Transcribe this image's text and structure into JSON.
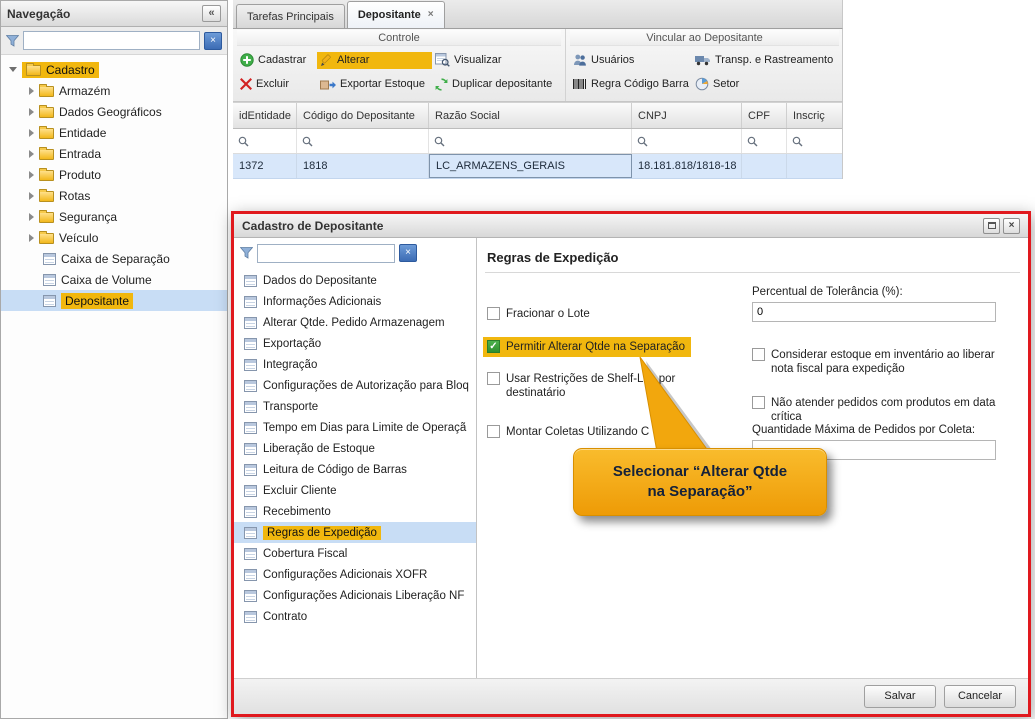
{
  "icons": {
    "collapse": "«",
    "close": "×",
    "clear": "×",
    "check": "✓"
  },
  "colors": {
    "highlight": "#f1b70e",
    "selection": "#c8ddf5",
    "callout": "#f0a40a",
    "red_frame": "#e0191e"
  },
  "nav": {
    "title": "Navegação",
    "filter_value": "",
    "items": [
      {
        "label": "Cadastro"
      },
      {
        "label": "Armazém"
      },
      {
        "label": "Dados Geográficos"
      },
      {
        "label": "Entidade"
      },
      {
        "label": "Entrada"
      },
      {
        "label": "Produto"
      },
      {
        "label": "Rotas"
      },
      {
        "label": "Segurança"
      },
      {
        "label": "Veículo"
      },
      {
        "label": "Caixa de Separação"
      },
      {
        "label": "Caixa de Volume"
      },
      {
        "label": "Depositante"
      }
    ]
  },
  "tabs": [
    {
      "label": "Tarefas Principais"
    },
    {
      "label": "Depositante"
    }
  ],
  "toolbar": {
    "group1_title": "Controle",
    "group2_title": "Vincular ao Depositante",
    "buttons": {
      "cadastrar": "Cadastrar",
      "alterar": "Alterar",
      "visualizar": "Visualizar",
      "excluir": "Excluir",
      "exportar": "Exportar Estoque",
      "duplicar": "Duplicar depositante",
      "usuarios": "Usuários",
      "transp": "Transp. e Rastreamento",
      "regra": "Regra Código Barra",
      "setor": "Setor"
    }
  },
  "grid": {
    "columns": [
      {
        "label": "idEntidade"
      },
      {
        "label": "Código do Depositante"
      },
      {
        "label": "Razão Social"
      },
      {
        "label": "CNPJ"
      },
      {
        "label": "CPF"
      },
      {
        "label": "Inscriç"
      }
    ],
    "row": {
      "id": "1372",
      "codigo": "1818",
      "razao": "LC_ARMAZENS_GERAIS",
      "cnpj": "18.181.818/1818-18",
      "cpf": "",
      "inscricao": ""
    }
  },
  "modal": {
    "title": "Cadastro de Depositante",
    "filter_value": "",
    "nav_items": [
      {
        "label": "Dados do Depositante"
      },
      {
        "label": "Informações Adicionais"
      },
      {
        "label": "Alterar Qtde. Pedido Armazenagem"
      },
      {
        "label": "Exportação"
      },
      {
        "label": "Integração"
      },
      {
        "label": "Configurações de Autorização para Bloq"
      },
      {
        "label": "Transporte"
      },
      {
        "label": "Tempo em Dias para Limite de Operaçã"
      },
      {
        "label": "Liberação de Estoque"
      },
      {
        "label": "Leitura de Código de Barras"
      },
      {
        "label": "Excluir Cliente"
      },
      {
        "label": "Recebimento"
      },
      {
        "label": "Regras de Expedição"
      },
      {
        "label": "Cobertura Fiscal"
      },
      {
        "label": "Configurações Adicionais XOFR"
      },
      {
        "label": "Configurações Adicionais Liberação NF"
      },
      {
        "label": "Contrato"
      }
    ],
    "panel_title": "Regras de Expedição",
    "fields": {
      "fracionar": "Fracionar o Lote",
      "permitir": "Permitir Alterar Qtde na Separação",
      "shelf": "Usar Restrições de Shelf-Life por destinatário",
      "montar": "Montar Coletas Utilizando C",
      "tolerancia_label": "Percentual de Tolerância (%):",
      "tolerancia_value": "0",
      "inventario": "Considerar estoque em inventário ao liberar nota fiscal para expedição",
      "critica": "Não atender pedidos com produtos em data crítica",
      "qtd_label": "Quantidade Máxima de Pedidos por Coleta:",
      "qtd_value": ""
    },
    "callout": {
      "line1": "Selecionar “Alterar Qtde",
      "line2": "na Separação”"
    },
    "buttons": {
      "salvar": "Salvar",
      "cancelar": "Cancelar"
    }
  }
}
